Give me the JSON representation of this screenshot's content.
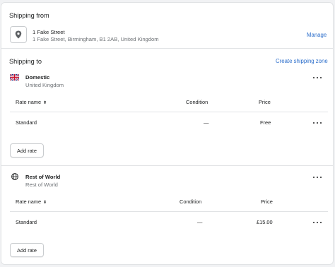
{
  "shipping_from": {
    "title": "Shipping from",
    "location_name": "1 Fake Street",
    "location_address": "1 Fake Street, Birmingham, B1 2AB, United Kingdom",
    "manage_label": "Manage",
    "icon": "location-pin-icon"
  },
  "shipping_to": {
    "title": "Shipping to",
    "create_zone_label": "Create shipping zone",
    "zones": [
      {
        "name": "Domestic",
        "region": "United Kingdom",
        "icon": "uk-flag-icon",
        "columns": {
          "rate_name": "Rate name",
          "sort_indicator": "⬍",
          "condition": "Condition",
          "price": "Price"
        },
        "rates": [
          {
            "name": "Standard",
            "condition": "—",
            "price": "Free"
          }
        ],
        "add_rate_label": "Add rate"
      },
      {
        "name": "Rest of World",
        "region": "Rest of World",
        "icon": "globe-icon",
        "columns": {
          "rate_name": "Rate name",
          "sort_indicator": "⬍",
          "condition": "Condition",
          "price": "Price"
        },
        "rates": [
          {
            "name": "Standard",
            "condition": "—",
            "price": "£15.00"
          }
        ],
        "add_rate_label": "Add rate"
      }
    ]
  },
  "colors": {
    "link": "#2c6ecb",
    "text": "#202223",
    "subdued": "#6d7175",
    "border": "#e1e3e5",
    "background": "#f1f2f4"
  }
}
